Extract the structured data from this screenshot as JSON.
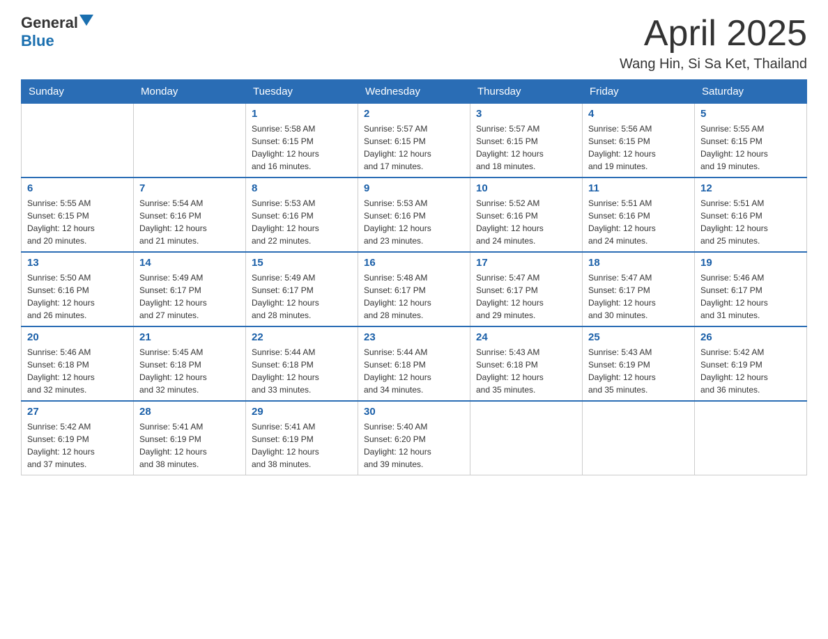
{
  "logo": {
    "text_general": "General",
    "text_blue": "Blue",
    "triangle_color": "#1a6faf"
  },
  "header": {
    "month_title": "April 2025",
    "subtitle": "Wang Hin, Si Sa Ket, Thailand"
  },
  "days_of_week": [
    "Sunday",
    "Monday",
    "Tuesday",
    "Wednesday",
    "Thursday",
    "Friday",
    "Saturday"
  ],
  "weeks": [
    [
      {
        "day": "",
        "info": ""
      },
      {
        "day": "",
        "info": ""
      },
      {
        "day": "1",
        "info": "Sunrise: 5:58 AM\nSunset: 6:15 PM\nDaylight: 12 hours\nand 16 minutes."
      },
      {
        "day": "2",
        "info": "Sunrise: 5:57 AM\nSunset: 6:15 PM\nDaylight: 12 hours\nand 17 minutes."
      },
      {
        "day": "3",
        "info": "Sunrise: 5:57 AM\nSunset: 6:15 PM\nDaylight: 12 hours\nand 18 minutes."
      },
      {
        "day": "4",
        "info": "Sunrise: 5:56 AM\nSunset: 6:15 PM\nDaylight: 12 hours\nand 19 minutes."
      },
      {
        "day": "5",
        "info": "Sunrise: 5:55 AM\nSunset: 6:15 PM\nDaylight: 12 hours\nand 19 minutes."
      }
    ],
    [
      {
        "day": "6",
        "info": "Sunrise: 5:55 AM\nSunset: 6:15 PM\nDaylight: 12 hours\nand 20 minutes."
      },
      {
        "day": "7",
        "info": "Sunrise: 5:54 AM\nSunset: 6:16 PM\nDaylight: 12 hours\nand 21 minutes."
      },
      {
        "day": "8",
        "info": "Sunrise: 5:53 AM\nSunset: 6:16 PM\nDaylight: 12 hours\nand 22 minutes."
      },
      {
        "day": "9",
        "info": "Sunrise: 5:53 AM\nSunset: 6:16 PM\nDaylight: 12 hours\nand 23 minutes."
      },
      {
        "day": "10",
        "info": "Sunrise: 5:52 AM\nSunset: 6:16 PM\nDaylight: 12 hours\nand 24 minutes."
      },
      {
        "day": "11",
        "info": "Sunrise: 5:51 AM\nSunset: 6:16 PM\nDaylight: 12 hours\nand 24 minutes."
      },
      {
        "day": "12",
        "info": "Sunrise: 5:51 AM\nSunset: 6:16 PM\nDaylight: 12 hours\nand 25 minutes."
      }
    ],
    [
      {
        "day": "13",
        "info": "Sunrise: 5:50 AM\nSunset: 6:16 PM\nDaylight: 12 hours\nand 26 minutes."
      },
      {
        "day": "14",
        "info": "Sunrise: 5:49 AM\nSunset: 6:17 PM\nDaylight: 12 hours\nand 27 minutes."
      },
      {
        "day": "15",
        "info": "Sunrise: 5:49 AM\nSunset: 6:17 PM\nDaylight: 12 hours\nand 28 minutes."
      },
      {
        "day": "16",
        "info": "Sunrise: 5:48 AM\nSunset: 6:17 PM\nDaylight: 12 hours\nand 28 minutes."
      },
      {
        "day": "17",
        "info": "Sunrise: 5:47 AM\nSunset: 6:17 PM\nDaylight: 12 hours\nand 29 minutes."
      },
      {
        "day": "18",
        "info": "Sunrise: 5:47 AM\nSunset: 6:17 PM\nDaylight: 12 hours\nand 30 minutes."
      },
      {
        "day": "19",
        "info": "Sunrise: 5:46 AM\nSunset: 6:17 PM\nDaylight: 12 hours\nand 31 minutes."
      }
    ],
    [
      {
        "day": "20",
        "info": "Sunrise: 5:46 AM\nSunset: 6:18 PM\nDaylight: 12 hours\nand 32 minutes."
      },
      {
        "day": "21",
        "info": "Sunrise: 5:45 AM\nSunset: 6:18 PM\nDaylight: 12 hours\nand 32 minutes."
      },
      {
        "day": "22",
        "info": "Sunrise: 5:44 AM\nSunset: 6:18 PM\nDaylight: 12 hours\nand 33 minutes."
      },
      {
        "day": "23",
        "info": "Sunrise: 5:44 AM\nSunset: 6:18 PM\nDaylight: 12 hours\nand 34 minutes."
      },
      {
        "day": "24",
        "info": "Sunrise: 5:43 AM\nSunset: 6:18 PM\nDaylight: 12 hours\nand 35 minutes."
      },
      {
        "day": "25",
        "info": "Sunrise: 5:43 AM\nSunset: 6:19 PM\nDaylight: 12 hours\nand 35 minutes."
      },
      {
        "day": "26",
        "info": "Sunrise: 5:42 AM\nSunset: 6:19 PM\nDaylight: 12 hours\nand 36 minutes."
      }
    ],
    [
      {
        "day": "27",
        "info": "Sunrise: 5:42 AM\nSunset: 6:19 PM\nDaylight: 12 hours\nand 37 minutes."
      },
      {
        "day": "28",
        "info": "Sunrise: 5:41 AM\nSunset: 6:19 PM\nDaylight: 12 hours\nand 38 minutes."
      },
      {
        "day": "29",
        "info": "Sunrise: 5:41 AM\nSunset: 6:19 PM\nDaylight: 12 hours\nand 38 minutes."
      },
      {
        "day": "30",
        "info": "Sunrise: 5:40 AM\nSunset: 6:20 PM\nDaylight: 12 hours\nand 39 minutes."
      },
      {
        "day": "",
        "info": ""
      },
      {
        "day": "",
        "info": ""
      },
      {
        "day": "",
        "info": ""
      }
    ]
  ]
}
